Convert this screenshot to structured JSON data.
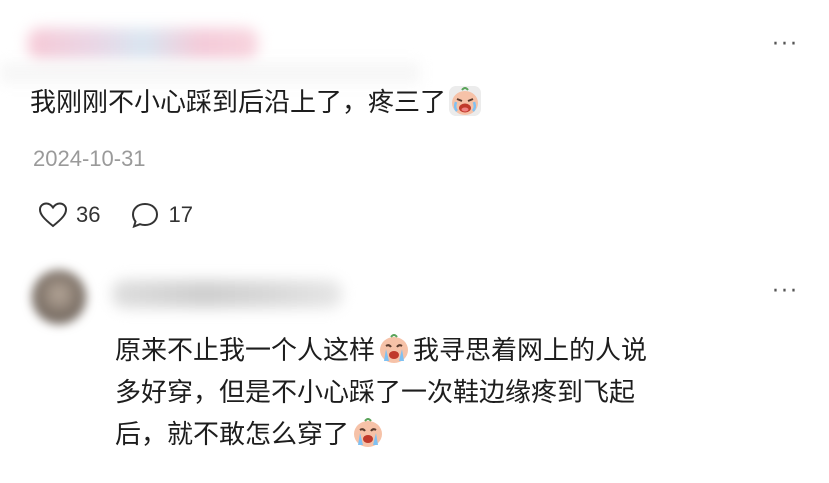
{
  "comments": [
    {
      "more_label": "···",
      "text_before": "我刚刚不小心踩到后沿上了，疼三了",
      "emoji_icon": "crying-face-icon",
      "date": "2024-10-31",
      "likes": "36",
      "replies": "17"
    },
    {
      "more_label": "···",
      "line1_a": "原来不止我一个人这样",
      "line1_b": "我寻思着网上的人说",
      "line2": "多好穿，但是不小心踩了一次鞋边缘疼到飞起",
      "line3": "后，就不敢怎么穿了",
      "emoji_icon": "crying-face-icon"
    }
  ],
  "colors": {
    "text": "#1d1d1d",
    "meta": "#9a9a9a",
    "emoji_face": "#f6c2a8",
    "emoji_tear": "#7fc1f2"
  }
}
